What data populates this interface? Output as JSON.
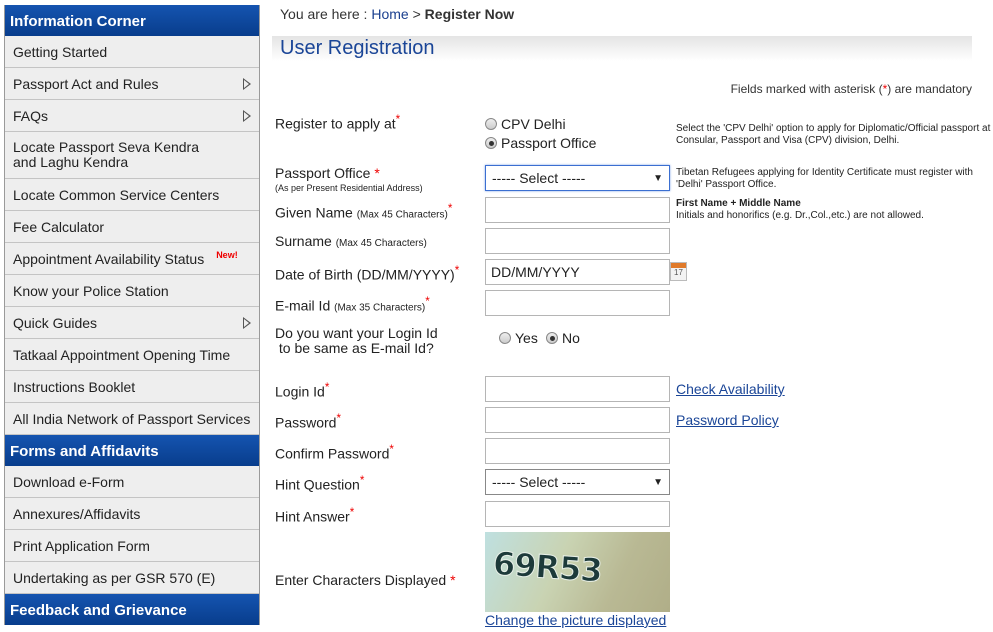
{
  "sidebar": {
    "sections": [
      {
        "title": "Information Corner",
        "items": [
          {
            "label": "Getting Started"
          },
          {
            "label": "Passport Act and Rules",
            "has_submenu": true
          },
          {
            "label": "FAQs",
            "has_submenu": true
          },
          {
            "label": "Locate Passport Seva Kendra and Laghu Kendra"
          },
          {
            "label": "Locate Common Service Centers"
          },
          {
            "label": "Fee Calculator"
          },
          {
            "label": "Appointment Availability Status",
            "badge": "New!"
          },
          {
            "label": "Know your Police Station"
          },
          {
            "label": "Quick Guides",
            "has_submenu": true
          },
          {
            "label": "Tatkaal Appointment Opening Time"
          },
          {
            "label": "Instructions Booklet"
          },
          {
            "label": "All India Network of Passport Services"
          }
        ]
      },
      {
        "title": "Forms and Affidavits",
        "items": [
          {
            "label": "Download e-Form"
          },
          {
            "label": "Annexures/Affidavits"
          },
          {
            "label": "Print Application Form"
          },
          {
            "label": "Undertaking as per GSR 570 (E)"
          }
        ]
      },
      {
        "title": "Feedback and Grievance",
        "items": []
      }
    ]
  },
  "breadcrumb": {
    "prefix": "You are here :",
    "home": "Home",
    "sep": ">",
    "current": "Register Now"
  },
  "page_title": "User Registration",
  "mandatory_note": {
    "before": "Fields marked with asterisk (",
    "asterisk": "*",
    "after": ") are mandatory"
  },
  "form": {
    "register_at": {
      "label": "Register to apply at",
      "options": [
        "CPV Delhi",
        "Passport Office"
      ],
      "selected": "Passport Office",
      "help": "Select the 'CPV Delhi' option to apply for Diplomatic/Official passport at Consular, Passport and Visa (CPV) division, Delhi."
    },
    "passport_office": {
      "label": "Passport Office",
      "sub": "(As per Present Residential Address)",
      "value": "----- Select -----",
      "help": "Tibetan Refugees applying for Identity Certificate must register with 'Delhi' Passport Office."
    },
    "given_name": {
      "label": "Given Name",
      "sub": "(Max 45 Characters)",
      "value": "",
      "help_title": "First Name + Middle Name",
      "help": "Initials and honorifics (e.g. Dr.,Col.,etc.) are not allowed."
    },
    "surname": {
      "label": "Surname",
      "sub": "(Max 45 Characters)",
      "value": ""
    },
    "dob": {
      "label": "Date of Birth (DD/MM/YYYY)",
      "value": "DD/MM/YYYY",
      "calendar_day": "17"
    },
    "email": {
      "label": "E-mail Id",
      "sub": "(Max 35 Characters)",
      "value": ""
    },
    "login_same": {
      "line1": "Do you want your Login Id",
      "line2": "to be same as E-mail Id?",
      "options": [
        "Yes",
        "No"
      ],
      "selected": "No"
    },
    "login_id": {
      "label": "Login Id",
      "value": "",
      "link": "Check Availability"
    },
    "password": {
      "label": "Password",
      "value": "",
      "link": "Password Policy"
    },
    "confirm_password": {
      "label": "Confirm Password",
      "value": ""
    },
    "hint_question": {
      "label": "Hint Question",
      "value": "----- Select -----"
    },
    "hint_answer": {
      "label": "Hint Answer",
      "value": ""
    },
    "captcha": {
      "label": "Enter Characters Displayed",
      "image_text": "69R53",
      "change_link": "Change the picture displayed"
    },
    "asterisk": "*"
  },
  "colors": {
    "header_blue": "#0a4499",
    "link": "#1a4597",
    "required": "#ee0000"
  }
}
